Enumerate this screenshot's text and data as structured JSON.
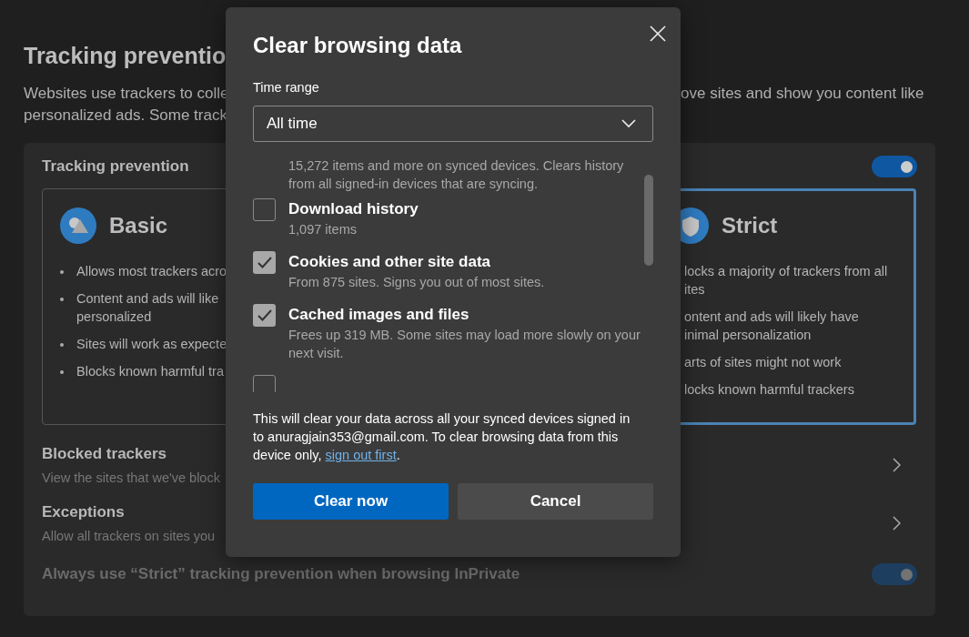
{
  "page": {
    "title": "Tracking preventio",
    "description_left": [
      "Websites use trackers to colle",
      "personalized ads. Some track"
    ],
    "description_right": "ove sites and show you content like"
  },
  "tracking_card": {
    "title": "Tracking prevention",
    "on": true,
    "options": [
      {
        "kind": "basic",
        "title": "Basic",
        "selected": false,
        "bullets": [
          "Allows most trackers acro",
          "Content and ads will like\npersonalized",
          "Sites will work as expecte",
          "Blocks known harmful tra"
        ]
      },
      {
        "kind": "strict",
        "title": "Strict",
        "selected": true,
        "bullets": [
          "locks a majority of trackers from all\nites",
          "ontent and ads will likely have\ninimal personalization",
          "arts of sites might not work",
          "locks known harmful trackers"
        ]
      }
    ],
    "links": [
      {
        "title": "Blocked trackers",
        "subtitle": "View the sites that we've block"
      },
      {
        "title": "Exceptions",
        "subtitle": "Allow all trackers on sites you"
      }
    ],
    "inprivate": {
      "label": "Always use “Strict” tracking prevention when browsing InPrivate",
      "on": true,
      "disabled": true
    }
  },
  "dialog": {
    "title": "Clear browsing data",
    "time_range_label": "Time range",
    "time_range_value": "All time",
    "items": [
      {
        "kind": "note",
        "description": "15,272 items and more on synced devices. Clears history from all signed-in devices that are syncing."
      },
      {
        "kind": "check",
        "label": "Download history",
        "description": "1,097 items",
        "checked": false
      },
      {
        "kind": "check",
        "label": "Cookies and other site data",
        "description": "From 875 sites. Signs you out of most sites.",
        "checked": true
      },
      {
        "kind": "check",
        "label": "Cached images and files",
        "description": "Frees up 319 MB. Some sites may load more slowly on your next visit.",
        "checked": true
      },
      {
        "kind": "check",
        "checked": false
      }
    ],
    "notice": "This will clear your data across all your synced devices signed in to anuragjain353@gmail.com. To clear browsing data from this device only,",
    "notice_link": "sign out first",
    "notice_end": ".",
    "buttons": [
      {
        "kind": "primary",
        "label": "Clear now"
      },
      {
        "kind": "secondary",
        "label": "Cancel"
      }
    ]
  }
}
